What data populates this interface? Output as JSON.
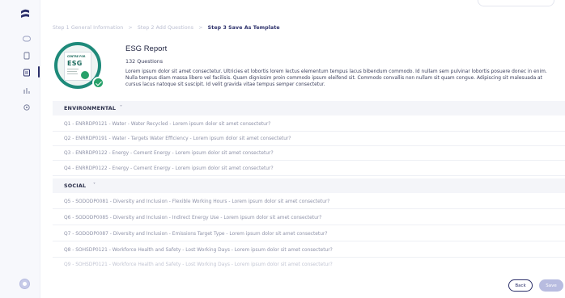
{
  "breadcrumb": {
    "step1": "Step 1 General Information",
    "step2": "Step 2 Add Questions",
    "step3": "Step 3 Save As Template",
    "separator": ">"
  },
  "report": {
    "badge_small_title": "CENTRE FOR",
    "badge_big": "ESG",
    "title": "ESG Report",
    "question_count": "132 Questions",
    "description": "Lorem ipsum dolor sit amet consectetur. Ultricies et lobortis lorem lectus elementum tempus lacus bibendum commodo. Id nullam sem pulvinar lobortis posuere donec in enim. Nulla tempus diam massa libero vel facilisis. Quam dignissim proin commodo ipsum eleifend sit. Commodo convallis non nullam sit quam congue. Adipiscing sit malesuada at cursus lacus natoque sit suscipit. Id velit gravida vitae tempus semper consectetur."
  },
  "sections": {
    "environmental": {
      "label": "ENVIRONMENTAL",
      "questions": [
        "Q1 - ENRRDP0121 - Water - Water Recycled - Lorem ipsum dolor sit amet consectetur?",
        "Q2 - ENRRDP0191 - Water - Targets Water Efficiency - Lorem ipsum dolor sit amet consectetur?",
        "Q3 - ENRRDP0122 - Energy - Cement Energy - Lorem ipsum dolor sit amet consectetur?",
        "Q4 - ENRRDP0122 - Energy - Cement Energy - Lorem ipsum dolor sit amet consectetur?"
      ]
    },
    "social": {
      "label": "SOCIAL",
      "questions": [
        "Q5 - SODODP0081 - Diversity and Inclusion - Flexible Working Hours - Lorem ipsum dolor sit amet consectetur?",
        "Q6 - SODODP0085 - Diversity and Inclusion - Indirect Energy Use - Lorem ipsum dolor sit amet consectetur?",
        "Q7 - SODODP0087 - Diversity and Inclusion - Emissions Target Type - Lorem ipsum dolor sit amet consectetur?",
        "Q8 - SOHSDP0121 - Workforce Health and Safety - Lost Working Days - Lorem ipsum dolor sit amet consectetur?",
        "Q9 - SOHSDP0121 - Workforce Health and Safety - Lost Working Days - Lorem ipsum dolor sit amet consectetur?"
      ]
    }
  },
  "chevron": "˅",
  "buttons": {
    "back": "Back",
    "save": "Save"
  },
  "colors": {
    "accent": "#2b2f6a",
    "badge_green": "#1e8a7a",
    "check_green": "#27a16a",
    "save_disabled": "#b8bce0"
  },
  "icons": {
    "logo": "brand-logo-icon",
    "nav": [
      "dashboard-icon",
      "document-icon",
      "report-icon",
      "chart-icon",
      "settings-icon"
    ],
    "help": "help-icon"
  }
}
